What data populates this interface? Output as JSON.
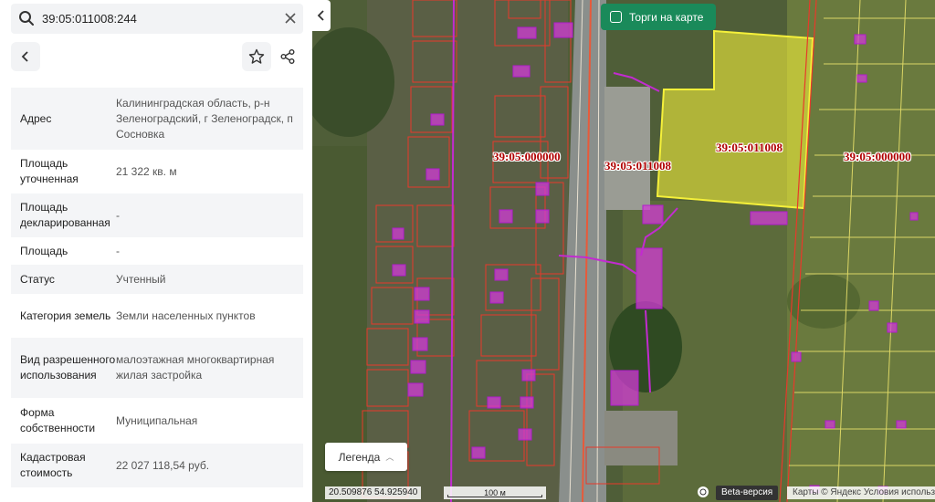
{
  "search": {
    "value": "39:05:011008:244"
  },
  "info_rows": [
    {
      "key": "Адрес",
      "value": "Калининградская область, р-н Зеленоградский, г Зеленоградск, п Сосновка"
    },
    {
      "key": "Площадь уточненная",
      "value": "21 322 кв. м"
    },
    {
      "key": "Площадь декларированная",
      "value": "-"
    },
    {
      "key": "Площадь",
      "value": "-"
    },
    {
      "key": "Статус",
      "value": "Учтенный"
    },
    {
      "key": "Категория земель",
      "value": "Земли населенных пунктов"
    },
    {
      "key": "Вид разрешенного использования",
      "value": "малоэтажная многоквартирная жилая застройка"
    },
    {
      "key": "Форма собственности",
      "value": "Муниципальная"
    },
    {
      "key": "Кадастровая стоимость",
      "value": "22 027 118,54 руб."
    }
  ],
  "map": {
    "torgi_label": "Торги на карте",
    "legend_label": "Легенда",
    "coords": "20.509876  54.925940",
    "scale_label": "100 м",
    "beta_label": "Beta-версия",
    "attribution": "Карты © Яндекс  Условия использования",
    "parcel_labels": [
      {
        "text": "39:05:000000"
      },
      {
        "text": "39:05:011008"
      },
      {
        "text": "39:05:011008"
      },
      {
        "text": "39:05:000000"
      }
    ],
    "colors": {
      "parcel_border": "#e8392a",
      "highlight": "#f2ee3a",
      "buildings": "#d23bd6",
      "torgi": "#1a8a5a"
    }
  }
}
